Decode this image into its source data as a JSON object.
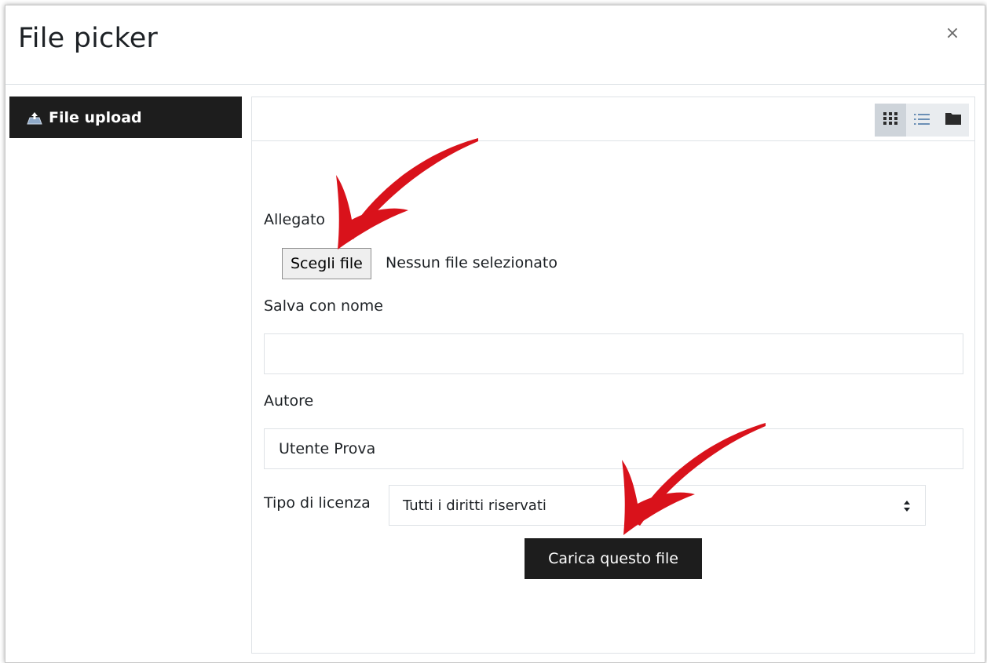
{
  "dialog": {
    "title": "File picker",
    "close_glyph": "×"
  },
  "sidebar": {
    "items": [
      {
        "label": "File upload",
        "icon": "upload-icon",
        "active": true
      }
    ]
  },
  "toolbar": {
    "views": [
      {
        "icon": "grid-icon",
        "active": true
      },
      {
        "icon": "list-icon",
        "active": false
      },
      {
        "icon": "folder-icon",
        "active": false
      }
    ]
  },
  "form": {
    "attachment_label": "Allegato",
    "choose_file_label": "Scegli file",
    "file_status": "Nessun file selezionato",
    "save_as_label": "Salva con nome",
    "save_as_value": "",
    "author_label": "Autore",
    "author_value": "Utente Prova",
    "license_label": "Tipo di licenza",
    "license_selected": "Tutti i diritti riservati",
    "submit_label": "Carica questo file"
  },
  "colors": {
    "dark_button": "#1d1d1d",
    "annotation_arrow": "#e0131b"
  }
}
